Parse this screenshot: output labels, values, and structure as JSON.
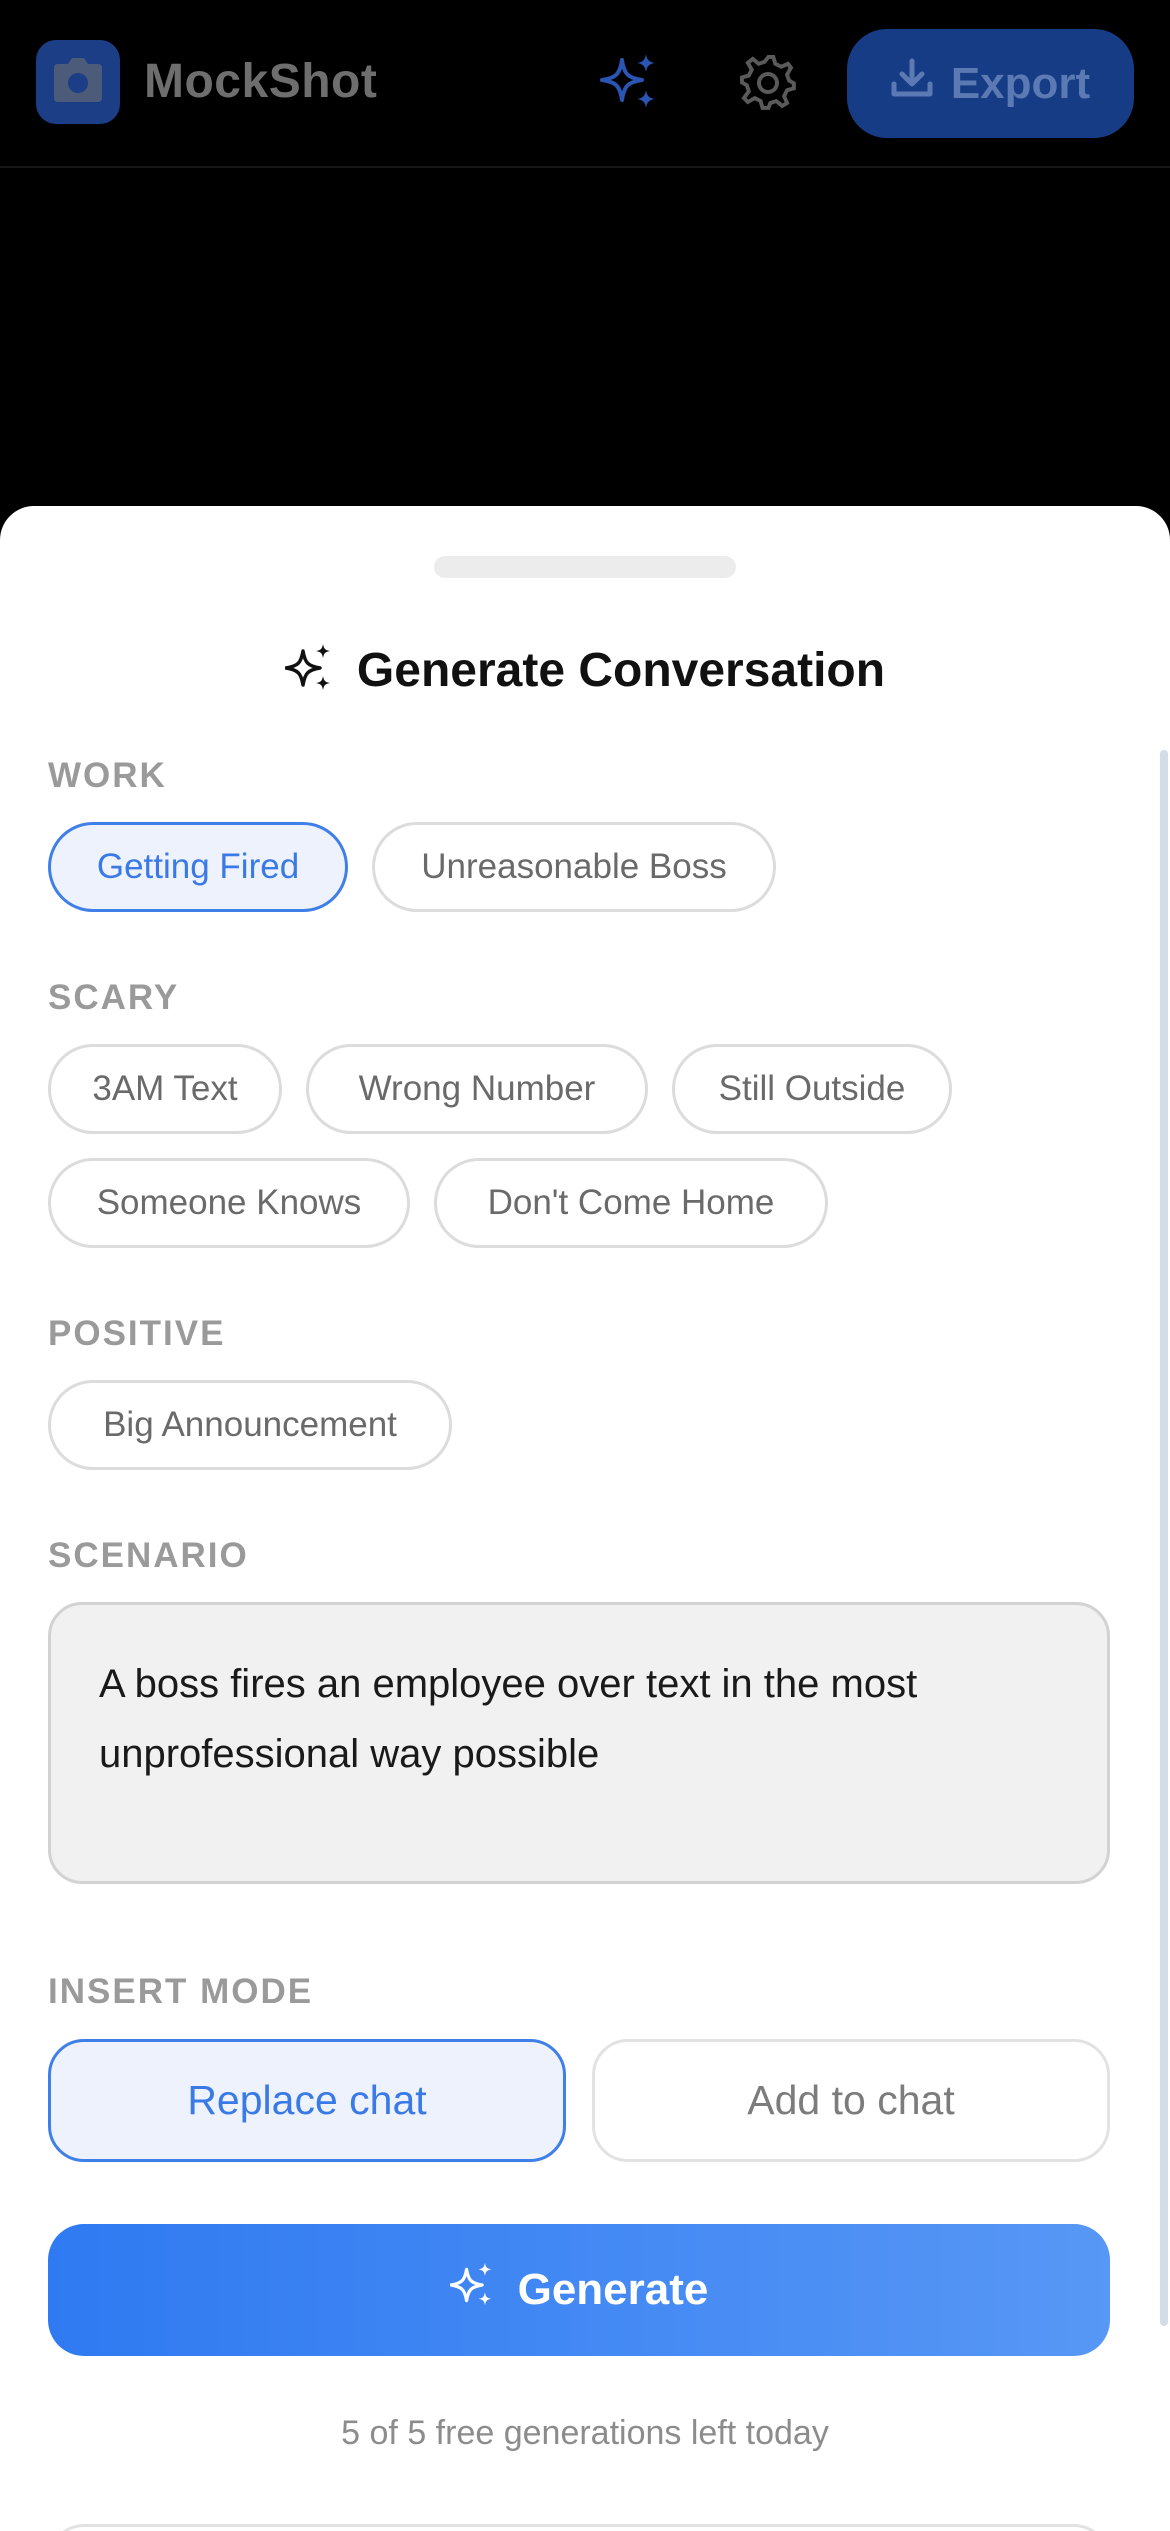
{
  "app": {
    "title": "MockShot",
    "logo_icon": "camera-icon",
    "brand_color": "#1c3e86"
  },
  "toolbar": {
    "ai_icon": "sparkles-icon",
    "settings_icon": "gear-icon",
    "export_label": "Export",
    "export_icon": "download-icon"
  },
  "sheet": {
    "title": "Generate Conversation",
    "title_icon": "sparkles-icon",
    "sections": [
      {
        "label": "WORK",
        "chips": [
          {
            "label": "Getting Fired",
            "selected": true
          },
          {
            "label": "Unreasonable Boss",
            "selected": false
          }
        ]
      },
      {
        "label": "SCARY",
        "chips": [
          {
            "label": "3AM Text",
            "selected": false
          },
          {
            "label": "Wrong Number",
            "selected": false
          },
          {
            "label": "Still Outside",
            "selected": false
          },
          {
            "label": "Someone Knows",
            "selected": false
          },
          {
            "label": "Don't Come Home",
            "selected": false
          }
        ]
      },
      {
        "label": "POSITIVE",
        "chips": [
          {
            "label": "Big Announcement",
            "selected": false
          }
        ]
      }
    ],
    "scenario": {
      "label": "SCENARIO",
      "value": "A boss fires an employee over text in the most unprofessional way possible"
    },
    "insert_mode": {
      "label": "INSERT MODE",
      "options": [
        {
          "label": "Replace chat",
          "selected": true
        },
        {
          "label": "Add to chat",
          "selected": false
        }
      ]
    },
    "generate_label": "Generate",
    "quota_text": "5 of 5 free generations left today"
  },
  "colors": {
    "accent": "#3a7ae6",
    "selected_bg": "#edf2fd",
    "generate_gradient_start": "#2f7af2",
    "generate_gradient_end": "#5797f5"
  }
}
